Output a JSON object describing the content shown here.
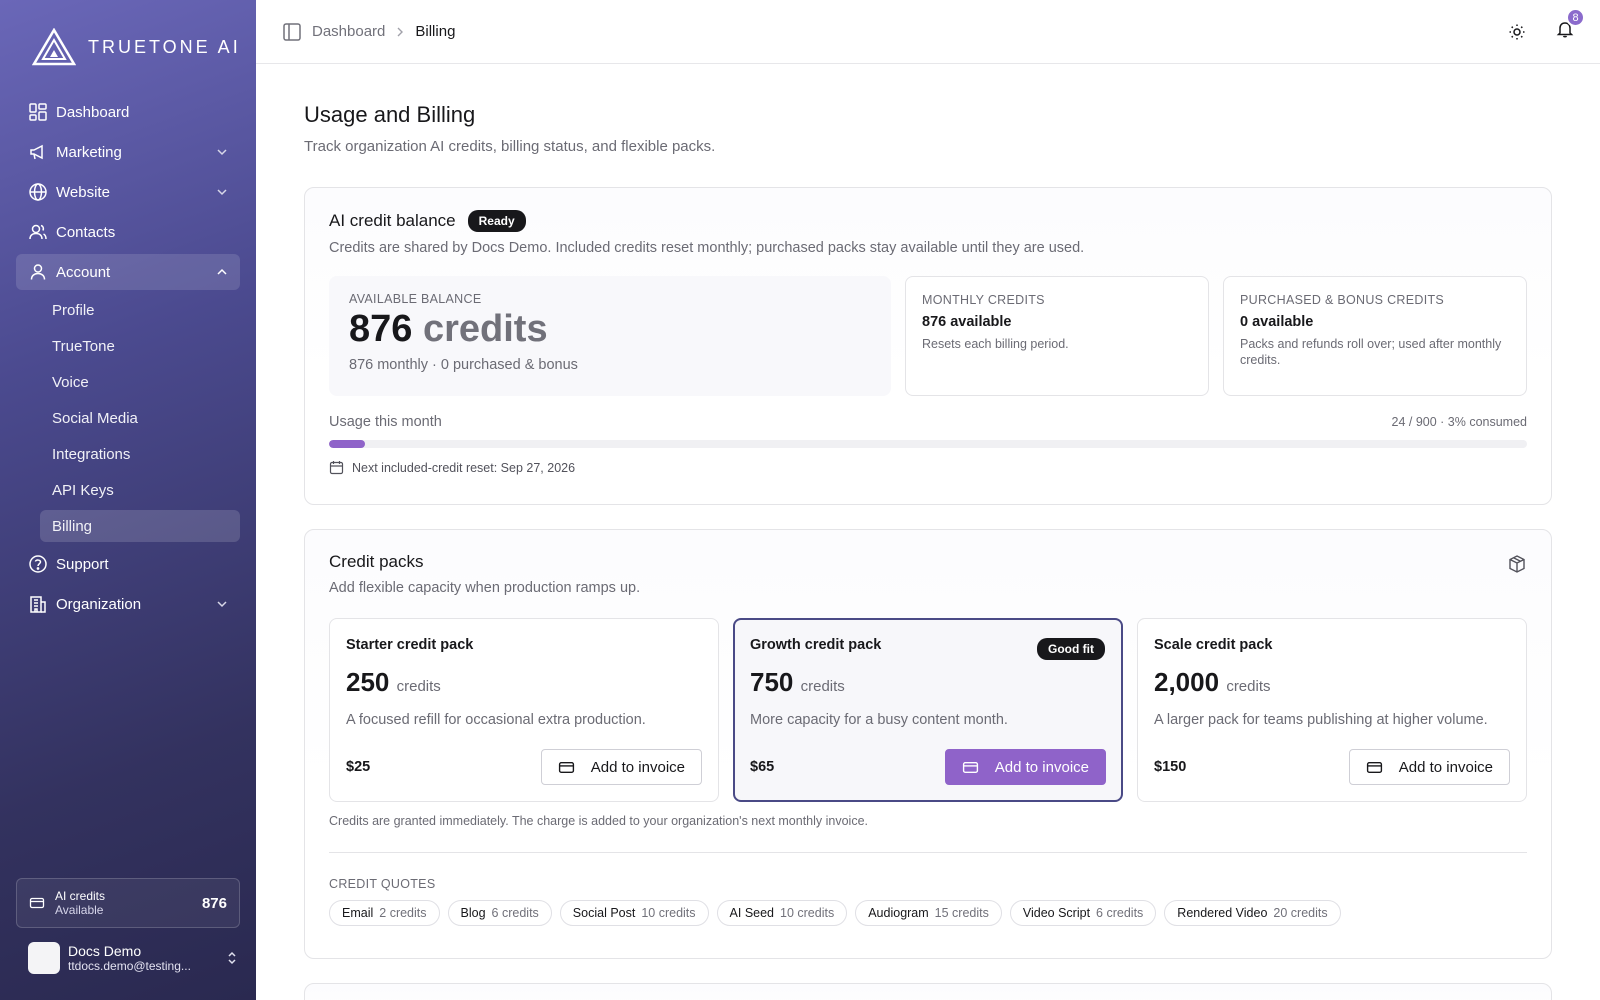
{
  "brand": {
    "name": "TRUETONE AI"
  },
  "sidebar": {
    "items": [
      {
        "label": "Dashboard",
        "icon": "grid-icon"
      },
      {
        "label": "Marketing",
        "icon": "megaphone-icon"
      },
      {
        "label": "Website",
        "icon": "globe-icon"
      },
      {
        "label": "Contacts",
        "icon": "users-icon"
      },
      {
        "label": "Account",
        "icon": "user-icon"
      }
    ],
    "account_sub": [
      "Profile",
      "TrueTone",
      "Voice",
      "Social Media",
      "Integrations",
      "API Keys",
      "Billing"
    ],
    "support": "Support",
    "organization": "Organization",
    "credits": {
      "label": "AI credits",
      "status": "Available",
      "value": "876"
    },
    "user": {
      "name": "Docs Demo",
      "email": "ttdocs.demo@testing..."
    }
  },
  "topbar": {
    "breadcrumb_root": "Dashboard",
    "breadcrumb_current": "Billing",
    "notification_count": "8"
  },
  "page": {
    "title": "Usage and Billing",
    "subtitle": "Track organization AI credits, billing status, and flexible packs."
  },
  "balance": {
    "title": "AI credit balance",
    "status": "Ready",
    "description": "Credits are shared by Docs Demo. Included credits reset monthly; purchased packs stay available until they are used.",
    "available_label": "AVAILABLE BALANCE",
    "available_value": "876",
    "available_unit": "credits",
    "available_breakdown": "876 monthly · 0 purchased & bonus",
    "monthly_label": "MONTHLY CREDITS",
    "monthly_value": "876 available",
    "monthly_note": "Resets each billing period.",
    "purchased_label": "PURCHASED & BONUS CREDITS",
    "purchased_value": "0 available",
    "purchased_note": "Packs and refunds roll over; used after monthly credits.",
    "usage_label": "Usage this month",
    "usage_summary": "24 / 900 · 3% consumed",
    "usage_fraction": 0.03,
    "reset_text": "Next included-credit reset: Sep 27, 2026"
  },
  "packs": {
    "title": "Credit packs",
    "description": "Add flexible capacity when production ramps up.",
    "items": [
      {
        "name": "Starter credit pack",
        "amount": "250",
        "unit": "credits",
        "desc": "A focused refill for occasional extra production.",
        "price": "$25",
        "cta": "Add to invoice"
      },
      {
        "name": "Growth credit pack",
        "amount": "750",
        "unit": "credits",
        "desc": "More capacity for a busy content month.",
        "price": "$65",
        "cta": "Add to invoice",
        "badge": "Good fit"
      },
      {
        "name": "Scale credit pack",
        "amount": "2,000",
        "unit": "credits",
        "desc": "A larger pack for teams publishing at higher volume.",
        "price": "$150",
        "cta": "Add to invoice"
      }
    ],
    "note": "Credits are granted immediately. The charge is added to your organization's next monthly invoice.",
    "quotes_label": "CREDIT QUOTES",
    "quotes": [
      {
        "name": "Email",
        "cost": "2 credits"
      },
      {
        "name": "Blog",
        "cost": "6 credits"
      },
      {
        "name": "Social Post",
        "cost": "10 credits"
      },
      {
        "name": "AI Seed",
        "cost": "10 credits"
      },
      {
        "name": "Audiogram",
        "cost": "15 credits"
      },
      {
        "name": "Video Script",
        "cost": "6 credits"
      },
      {
        "name": "Rendered Video",
        "cost": "20 credits"
      }
    ]
  },
  "colors": {
    "accent": "#8f63c9",
    "sidebar_top": "#6a67b8",
    "sidebar_bottom": "#2a2950",
    "highlight_border": "#4a4a86"
  }
}
